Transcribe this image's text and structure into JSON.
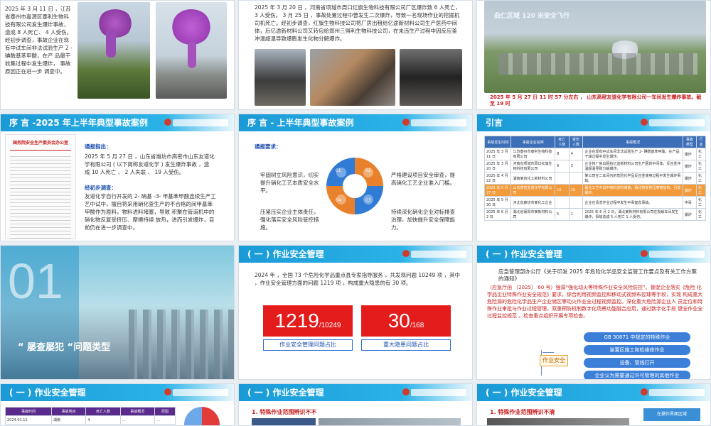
{
  "colors": {
    "header_blue": "#1a9ad6",
    "accent_red": "#e51c1c",
    "text_blue": "#1a4db0",
    "orange": "#f39a3a"
  },
  "s1": {
    "text": "2025 年 3 月 11 日 ，江苏省泰州市嘉源区泰利生物科技有限公司发生爆炸事故，造成 8 人死亡、 4 人受伤。经初步调查，事故企业在现有中试车间非法试验生产 2 - 碘酰基苯甲酸，在产 品最干收集过程中发生爆炸， 事故原因正在进一步 调查中。"
  },
  "s2": {
    "text": "2025 年 3 月 20 日 ，河南省项城市周口红旗生物科技有限公司厂区爆炸致 6 人死亡， 3 人受伤。 3 月 25 日 ，事故处置过程中曾发生二次爆炸，导致一名现场作业的挖掘机司机死亡。经初步调查，红旗生物科技公司将厂房出租给亿途新材料公司生产医药中间体，后亿途新材料公司又转包给郑州三得利生物科技公司，在未违生产过程中因反应釜冲温超温导致爆膨发生化物分解爆炸。"
  },
  "s3": {
    "watermark": "曲仁区域 120 米安全飞行",
    "caption": "2025 年 5 月 27 日 11 时 57 分左右 ， 山东高密友道化学有限公司一车间发生爆炸事故。截至 19 时"
  },
  "s4": {
    "header": "序 言 -2025 年上半年典型事故案例",
    "doc_title": "国务院安全生产委员会办公室",
    "intro": "通报指出：",
    "text1": "2025 年 5 月 27 日 ，山东省潍坊市高密市山东友道化学有限公司 ( 以下简称友道化学 ) 发生爆炸事故 ，造 成 10 人死亡 、 2 人失联 、 19 人受伤。",
    "text2_label": "经初步调查：",
    "text2": "友道化学自行开发的 2- 硝基 -3- 甲基苯甲酸连续生产工艺中试中，擅自将采用硝化釜生产的不合格的间甲基苯甲酸作为原料，物料进料堵塞，导致 积聚在管道机中的硝化物反复受挤压、摩擦持续 放热，进而引发爆炸，目前仍在进一步调查中。"
  },
  "s5": {
    "header": "序 言 - 上半年典型事故案例",
    "intro": "通报要求：",
    "items": [
      {
        "num": "01",
        "text": "牢固树立风险意识，切实提升硝化工艺本质安全水平。"
      },
      {
        "num": "02",
        "text": "严格建设项目安全审查，提高硝化工艺企业准入门槛。"
      },
      {
        "num": "03",
        "text": "持续深化硝化企业对标排查治理，加快提升安全保障能力。"
      },
      {
        "num": "04",
        "text": "压紧压实企业主体责任，强化落实安全风险管控措施。"
      }
    ]
  },
  "s6": {
    "header": "引言",
    "columns": [
      "事故发生时间",
      "事故企业名称",
      "死亡人数",
      "受伤人数",
      "事故概况",
      "事故类型",
      "行业"
    ],
    "rows": [
      [
        "2025 年 3 月 11 日",
        "江苏泰州市泰利生物科技有限公司",
        "8",
        "4",
        "企业在现有中试车间非法试验生产 2- 碘酰基苯甲酸，在产品干燥过程中发生爆炸。",
        "爆炸",
        "化工"
      ],
      [
        "2025 年 3 月 20 日",
        "河南省项城市周口红旗生物科技有限公司",
        "6",
        "3",
        "企业将厂房出租给亿途新材料公司生产医药中间体，反应釜冲温超温导致分解爆炸。",
        "爆炸",
        "化工"
      ],
      [
        "2025 年 4 月 22 日",
        "湖南某省化工新材料公司",
        "",
        "",
        "某公司在二车间内的危险化学品反应釜使用过程中发生爆炸事故。",
        "爆炸",
        "化工"
      ],
      [
        "2025 年 5 月 27 日",
        "山东高密友道化学有限公司",
        "10",
        "19",
        "硝化工艺中试中物料进料堵塞，硝化物受挤压摩擦放热，引发爆炸。",
        "爆炸",
        "化工"
      ],
      [
        "2025 年 5 月 30 日",
        "河北省廊坊市某化工企业",
        "",
        "",
        "企业在清洗作业过程中发生中毒窒息事故。",
        "中毒",
        "化工"
      ],
      [
        "2025 年 6 月 2 日",
        "湖北省襄阳市某新材料公司",
        "5",
        "1",
        "2025 年 6 月 2 日，湖北某新材料有限公司在裂解车间发生爆炸，事故造成 5 人死亡 1 人受伤。",
        "爆炸",
        "化工"
      ]
    ]
  },
  "s7": {
    "big_number": "01",
    "title": "“ 屡查屡犯 “问题类型"
  },
  "s8": {
    "header": "( 一 ) 作业安全管理",
    "text": "2024 年 ，全国 73 个危险化学品重点县专家指导服务 ，共发现问题 10249 项 ，其中 ，作业安全管理方面的问题 1219 项 ，构成重大隐患的有 30 项。",
    "stat1_main": "1219",
    "stat1_sub": "/10249",
    "stat1_label": "作业安全管理问题占比",
    "stat2_main": "30",
    "stat2_sub": "/168",
    "stat2_label": "重大隐患问题占比"
  },
  "s9": {
    "header": "( 一 ) 作业安全管理",
    "text_head": "应急管理部办公厅《关于印发 2025 年危险化学品安全监管工作要点及有关工作方案的通知》",
    "text_mid": "（应急厅函 〔2025〕 60 号）强调“强化动火等特殊作业安全风险防控”。督促企业落实《危险 化学品企业特殊作业安全规范》要求，综合利用视频监控和移动式视频布控球等手段，实现 构成重大危险源的危险化学品生产企业储区等动火作业全过程视频监控。深化重大危险源企业人 员定位和特殊作业审批与作业过程管理，双重预防机制数字化场景功能融合应用，通过数字化手段 健全作业全过程监控规范 。检查重点组织开展专项检查。",
    "root": "作业安全",
    "branches": [
      "GB 30871 中规定的特殊作业",
      "装置区施工和检维修作业",
      "设备、管线打开",
      "企业认为需要通过许可管理的其他作业"
    ]
  },
  "s10": {
    "header": "( 一 ) 作业安全管理",
    "columns": [
      "事故时间",
      "事故地点",
      "死亡人数",
      "事故概况",
      "原因"
    ],
    "row": [
      "2024.01.11",
      "湖南",
      "4",
      "…",
      "…"
    ]
  },
  "s11": {
    "header": "( 一 ) 作业安全管理",
    "subtitle": "1. 特殊作业范围辨识不不"
  },
  "s12": {
    "header": "( 一 ) 作业安全管理",
    "subtitle": "1. 特殊作业范围辨识不清",
    "callout": "在操作界面区域"
  }
}
